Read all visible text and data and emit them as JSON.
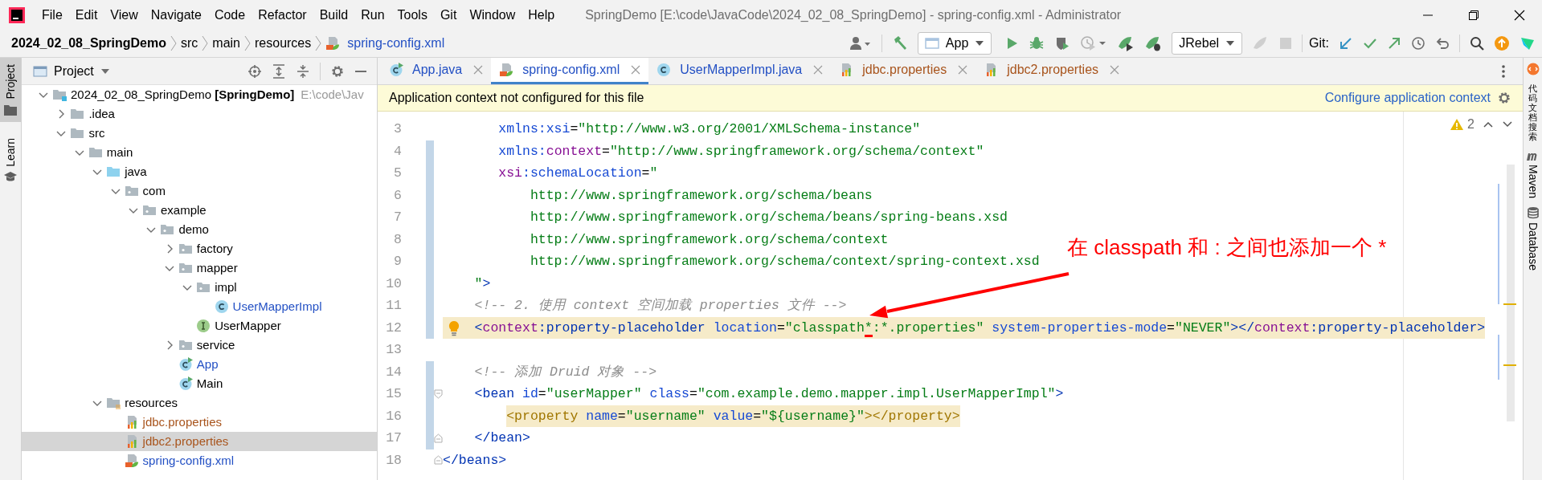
{
  "window": {
    "title": "SpringDemo [E:\\code\\JavaCode\\2024_02_08_SpringDemo] - spring-config.xml - Administrator"
  },
  "menu": [
    "File",
    "Edit",
    "View",
    "Navigate",
    "Code",
    "Refactor",
    "Build",
    "Run",
    "Tools",
    "Git",
    "Window",
    "Help"
  ],
  "breadcrumbs": [
    {
      "label": "2024_02_08_SpringDemo",
      "kind": "project"
    },
    {
      "label": "src",
      "kind": "folder"
    },
    {
      "label": "main",
      "kind": "folder"
    },
    {
      "label": "resources",
      "kind": "folder"
    },
    {
      "label": "spring-config.xml",
      "kind": "xml"
    }
  ],
  "toolbar": {
    "run_config": "App",
    "jrebel_config": "JRebel",
    "git_label": "Git:"
  },
  "left_stripe": [
    {
      "label": "Project",
      "selected": true
    },
    {
      "label": "Learn",
      "selected": false
    }
  ],
  "project_panel": {
    "title": "Project",
    "tree": [
      {
        "label": "2024_02_08_SpringDemo",
        "module": "[SpringDemo]",
        "path": "E:\\code\\Jav",
        "kind": "module",
        "expanded": true,
        "selected": false,
        "children": [
          {
            "label": ".idea",
            "kind": "folder",
            "expanded": false,
            "selected": false
          },
          {
            "label": "src",
            "kind": "folder",
            "expanded": true,
            "selected": false,
            "children": [
              {
                "label": "main",
                "kind": "folder",
                "expanded": true,
                "selected": false,
                "children": [
                  {
                    "label": "java",
                    "kind": "source",
                    "expanded": true,
                    "selected": false,
                    "children": [
                      {
                        "label": "com",
                        "kind": "package",
                        "expanded": true,
                        "selected": false,
                        "children": [
                          {
                            "label": "example",
                            "kind": "package",
                            "expanded": true,
                            "selected": false,
                            "children": [
                              {
                                "label": "demo",
                                "kind": "package",
                                "expanded": true,
                                "selected": false,
                                "children": [
                                  {
                                    "label": "factory",
                                    "kind": "package",
                                    "expanded": false,
                                    "selected": false
                                  },
                                  {
                                    "label": "mapper",
                                    "kind": "package",
                                    "expanded": true,
                                    "selected": false,
                                    "children": [
                                      {
                                        "label": "impl",
                                        "kind": "package",
                                        "expanded": true,
                                        "selected": false,
                                        "children": [
                                          {
                                            "label": "UserMapperImpl",
                                            "kind": "class",
                                            "color": "#2350c4",
                                            "selected": false
                                          }
                                        ]
                                      },
                                      {
                                        "label": "UserMapper",
                                        "kind": "interface",
                                        "selected": false
                                      }
                                    ]
                                  },
                                  {
                                    "label": "service",
                                    "kind": "package",
                                    "expanded": false,
                                    "selected": false
                                  },
                                  {
                                    "label": "App",
                                    "kind": "runnable",
                                    "color": "#2350c4",
                                    "selected": false
                                  },
                                  {
                                    "label": "Main",
                                    "kind": "runnable",
                                    "selected": false
                                  }
                                ]
                              }
                            ]
                          }
                        ]
                      }
                    ]
                  },
                  {
                    "label": "resources",
                    "kind": "resources",
                    "expanded": true,
                    "selected": false,
                    "children": [
                      {
                        "label": "jdbc.properties",
                        "kind": "properties",
                        "color": "#a8541c",
                        "selected": false
                      },
                      {
                        "label": "jdbc2.properties",
                        "kind": "properties",
                        "color": "#a8541c",
                        "selected": true
                      },
                      {
                        "label": "spring-config.xml",
                        "kind": "xml",
                        "color": "#2350c4",
                        "selected": false
                      }
                    ]
                  }
                ]
              }
            ]
          }
        ]
      }
    ]
  },
  "editor": {
    "tabs": [
      {
        "label": "App.java",
        "kind": "runnable",
        "color": "#2350c4",
        "selected": false
      },
      {
        "label": "spring-config.xml",
        "kind": "xml",
        "color": "#2350c4",
        "selected": true
      },
      {
        "label": "UserMapperImpl.java",
        "kind": "class",
        "color": "#2350c4",
        "selected": false
      },
      {
        "label": "jdbc.properties",
        "kind": "properties",
        "color": "#a8541c",
        "selected": false
      },
      {
        "label": "jdbc2.properties",
        "kind": "properties",
        "color": "#a8541c",
        "selected": false
      }
    ],
    "banner": {
      "message": "Application context not configured for this file",
      "action": "Configure application context"
    },
    "warnings": "2",
    "lines": [
      {
        "number": "3",
        "kind": "plain",
        "changed": false,
        "caret_line": false,
        "bulb": false,
        "matched": false,
        "tokens": [
          {
            "kind": "attr",
            "text": "       xmlns:xsi"
          },
          {
            "kind": "plain",
            "text": "="
          },
          {
            "kind": "str",
            "text": "\"http://www.w3.org/2001/XMLSchema-instance\""
          }
        ]
      },
      {
        "number": "4",
        "kind": "plain",
        "changed": true,
        "caret_line": false,
        "bulb": false,
        "matched": false,
        "tokens": [
          {
            "kind": "attr",
            "text": "       xmlns:"
          },
          {
            "kind": "ns",
            "text": "context"
          },
          {
            "kind": "plain",
            "text": "="
          },
          {
            "kind": "str",
            "text": "\"http://www.springframework.org/schema/context\""
          }
        ]
      },
      {
        "number": "5",
        "kind": "plain",
        "changed": true,
        "caret_line": false,
        "bulb": false,
        "matched": false,
        "tokens": [
          {
            "kind": "ns",
            "text": "       xsi"
          },
          {
            "kind": "attr",
            "text": ":schemaLocation"
          },
          {
            "kind": "plain",
            "text": "="
          },
          {
            "kind": "str",
            "text": "\""
          }
        ]
      },
      {
        "number": "6",
        "kind": "plain",
        "changed": true,
        "caret_line": false,
        "bulb": false,
        "matched": false,
        "tokens": [
          {
            "kind": "str",
            "text": "           http://www.springframework.org/schema/beans"
          }
        ]
      },
      {
        "number": "7",
        "kind": "plain",
        "changed": true,
        "caret_line": false,
        "bulb": false,
        "matched": false,
        "tokens": [
          {
            "kind": "str",
            "text": "           http://www.springframework.org/schema/beans/spring-beans.xsd"
          }
        ]
      },
      {
        "number": "8",
        "kind": "plain",
        "changed": true,
        "caret_line": false,
        "bulb": false,
        "matched": false,
        "tokens": [
          {
            "kind": "str",
            "text": "           http://www.springframework.org/schema/context"
          }
        ]
      },
      {
        "number": "9",
        "kind": "plain",
        "changed": true,
        "caret_line": false,
        "bulb": false,
        "matched": false,
        "tokens": [
          {
            "kind": "str",
            "text": "           http://www.springframework.org/schema/context/spring-context.xsd"
          }
        ]
      },
      {
        "number": "10",
        "kind": "plain",
        "changed": true,
        "caret_line": false,
        "bulb": false,
        "matched": false,
        "tokens": [
          {
            "kind": "str",
            "text": "    \""
          },
          {
            "kind": "tag",
            "text": ">"
          }
        ]
      },
      {
        "number": "11",
        "kind": "plain",
        "changed": true,
        "caret_line": false,
        "bulb": false,
        "matched": false,
        "tokens": [
          {
            "kind": "comment",
            "text": "    <!-- 2. 使用 context 空间加载 properties 文件 -->"
          }
        ]
      },
      {
        "number": "12",
        "kind": "plain",
        "changed": true,
        "caret_line": true,
        "bulb": true,
        "matched": false,
        "tokens": [
          {
            "kind": "tag",
            "text": "    <"
          },
          {
            "kind": "ns",
            "text": "context"
          },
          {
            "kind": "tag",
            "text": ":property-placeholder"
          },
          {
            "kind": "attr",
            "text": " location"
          },
          {
            "kind": "plain",
            "text": "="
          },
          {
            "kind": "str",
            "text": "\"classpath"
          },
          {
            "kind": "str",
            "text": "*",
            "underlined": true
          },
          {
            "kind": "str",
            "text": ":*.properties\""
          },
          {
            "kind": "attr",
            "text": " system-properties-mode"
          },
          {
            "kind": "plain",
            "text": "="
          },
          {
            "kind": "str",
            "text": "\"NEVER\""
          },
          {
            "kind": "tag",
            "text": "></"
          },
          {
            "kind": "ns",
            "text": "context"
          },
          {
            "kind": "tag",
            "text": ":property-placeholder>"
          }
        ]
      },
      {
        "number": "13",
        "kind": "plain",
        "changed": false,
        "caret_line": false,
        "bulb": false,
        "matched": false
      },
      {
        "number": "14",
        "kind": "plain",
        "changed": true,
        "caret_line": false,
        "bulb": false,
        "matched": false,
        "tokens": [
          {
            "kind": "comment",
            "text": "    <!-- 添加 Druid 对象 -->"
          }
        ]
      },
      {
        "number": "15",
        "kind": "foldstart",
        "changed": true,
        "caret_line": false,
        "bulb": false,
        "matched": false,
        "tokens": [
          {
            "kind": "tag",
            "text": "    <bean"
          },
          {
            "kind": "attr",
            "text": " id"
          },
          {
            "kind": "plain",
            "text": "="
          },
          {
            "kind": "str",
            "text": "\"userMapper\""
          },
          {
            "kind": "attr",
            "text": " class"
          },
          {
            "kind": "plain",
            "text": "="
          },
          {
            "kind": "str",
            "text": "\"com.example.demo.mapper.impl.UserMapperImpl\""
          },
          {
            "kind": "tag",
            "text": ">"
          }
        ]
      },
      {
        "number": "16",
        "kind": "plain",
        "changed": true,
        "caret_line": false,
        "bulb": false,
        "matched": true,
        "tokens": [
          {
            "kind": "hltag",
            "text": "        <property"
          },
          {
            "kind": "attr",
            "text": " name"
          },
          {
            "kind": "plain",
            "text": "="
          },
          {
            "kind": "str",
            "text": "\"username\""
          },
          {
            "kind": "attr",
            "text": " value"
          },
          {
            "kind": "plain",
            "text": "="
          },
          {
            "kind": "str",
            "text": "\"${username}\""
          },
          {
            "kind": "hltag",
            "text": "></property>"
          }
        ]
      },
      {
        "number": "17",
        "kind": "foldend",
        "changed": true,
        "caret_line": false,
        "bulb": false,
        "matched": false,
        "tokens": [
          {
            "kind": "tag",
            "text": "    </bean>"
          }
        ]
      },
      {
        "number": "18",
        "kind": "foldend",
        "changed": false,
        "caret_line": false,
        "bulb": false,
        "matched": false,
        "tokens": [
          {
            "kind": "tag",
            "text": "</beans>"
          }
        ]
      }
    ],
    "annotation": {
      "text": "在 classpath 和 : 之间也添加一个 *"
    }
  },
  "right_stripe": [
    {
      "label": "代码文档搜索",
      "kind": "cjk"
    },
    {
      "label": "Maven",
      "kind": "maven"
    },
    {
      "label": "Database",
      "kind": "database"
    }
  ]
}
